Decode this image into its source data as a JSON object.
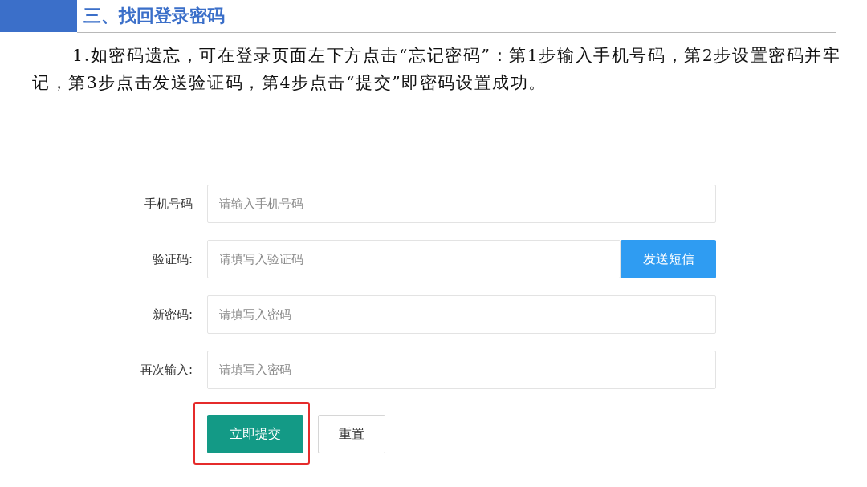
{
  "heading": {
    "title": "三、找回登录密码"
  },
  "paragraph": "1.如密码遗忘，可在登录页面左下方点击“忘记密码”：第1步输入手机号码，第2步设置密码并牢记，第3步点击发送验证码，第4步点击“提交”即密码设置成功。",
  "form": {
    "fields": [
      {
        "label": "手机号码",
        "placeholder": "请输入手机号码"
      },
      {
        "label": "验证码:",
        "placeholder": "请填写入验证码",
        "action": "发送短信"
      },
      {
        "label": "新密码:",
        "placeholder": "请填写入密码"
      },
      {
        "label": "再次输入:",
        "placeholder": "请填写入密码"
      }
    ],
    "buttons": [
      {
        "label": "立即提交",
        "kind": "primary",
        "highlighted": true
      },
      {
        "label": "重置",
        "kind": "secondary",
        "highlighted": false
      }
    ]
  }
}
